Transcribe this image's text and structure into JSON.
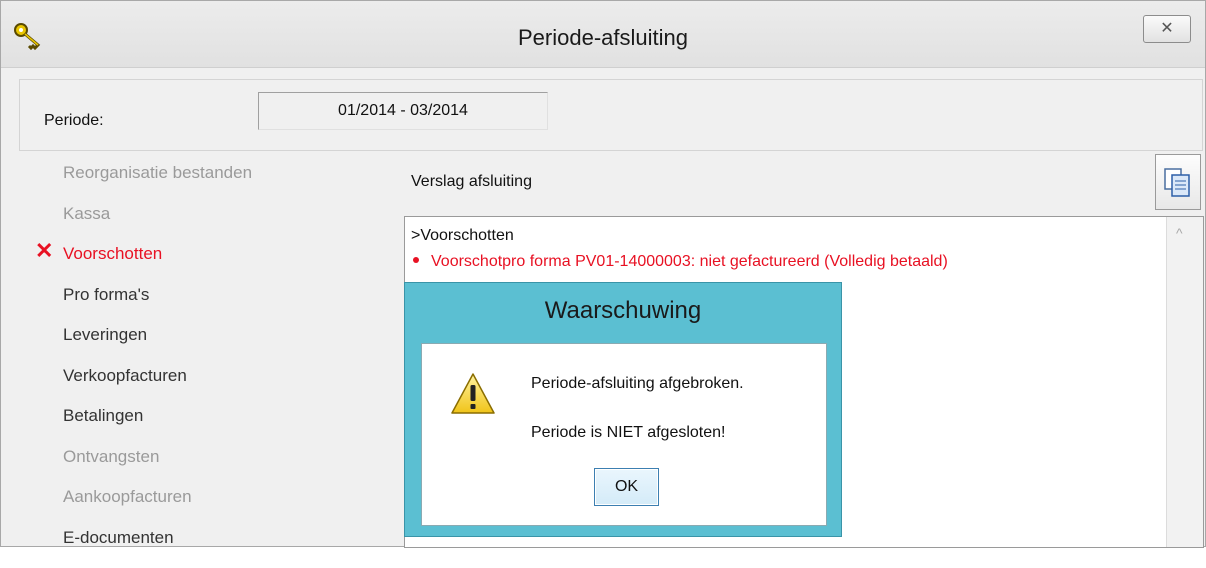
{
  "window": {
    "title": "Periode-afsluiting",
    "close_label": "✕"
  },
  "periode": {
    "label": "Periode:",
    "value": "01/2014 - 03/2014"
  },
  "steps": [
    {
      "label": "Reorganisatie bestanden",
      "state": "disabled"
    },
    {
      "label": "Kassa",
      "state": "disabled"
    },
    {
      "label": "Voorschotten",
      "state": "error",
      "icon": "error-x-icon"
    },
    {
      "label": "Pro forma's",
      "state": "normal"
    },
    {
      "label": "Leveringen",
      "state": "normal"
    },
    {
      "label": "Verkoopfacturen",
      "state": "normal"
    },
    {
      "label": "Betalingen",
      "state": "normal"
    },
    {
      "label": "Ontvangsten",
      "state": "disabled"
    },
    {
      "label": "Aankoopfacturen",
      "state": "disabled"
    },
    {
      "label": "E-documenten",
      "state": "normal"
    }
  ],
  "report": {
    "label": "Verslag afsluiting",
    "lines": [
      ">Voorschotten",
      "Voorschotpro forma PV01-14000003: niet gefactureerd (Volledig betaald)"
    ]
  },
  "dialog": {
    "title": "Waarschuwing",
    "message1": "Periode-afsluiting afgebroken.",
    "message2": "Periode is NIET afgesloten!",
    "ok_label": "OK",
    "icon": "warning-icon"
  },
  "colors": {
    "error": "#e81123",
    "dialog_frame": "#5bbfd2"
  }
}
